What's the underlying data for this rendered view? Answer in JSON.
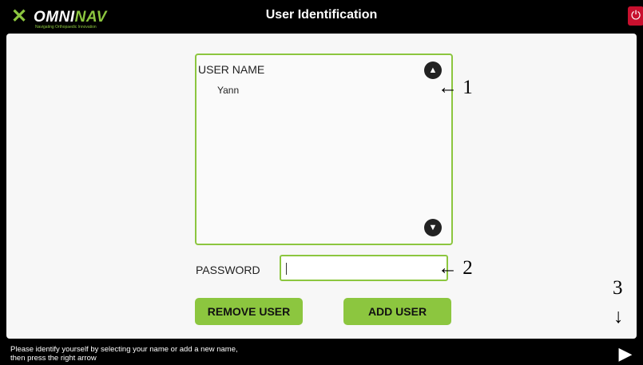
{
  "header": {
    "logo_text_a": "OMNI",
    "logo_text_b": "NAV",
    "logo_tagline": "Navigating Orthopaedic Innovation",
    "title": "User Identification",
    "power_icon": "power-icon"
  },
  "user_list": {
    "label": "USER NAME",
    "items": [
      "Yann"
    ],
    "scroll_up_icon": "arrow-up-circle-icon",
    "scroll_down_icon": "arrow-down-circle-icon"
  },
  "password": {
    "label": "PASSWORD",
    "value": ""
  },
  "buttons": {
    "remove_label": "REMOVE USER",
    "add_label": "ADD USER"
  },
  "annotations": {
    "one": "← 1",
    "two": "← 2",
    "three": "3",
    "three_arrow": "↓"
  },
  "footer": {
    "instruction_line1": "Please identify yourself by selecting your name or add a new name,",
    "instruction_line2": " then press the right arrow",
    "next_icon": "right-arrow-icon"
  },
  "colors": {
    "accent": "#8cc63f",
    "power": "#c8102e"
  }
}
